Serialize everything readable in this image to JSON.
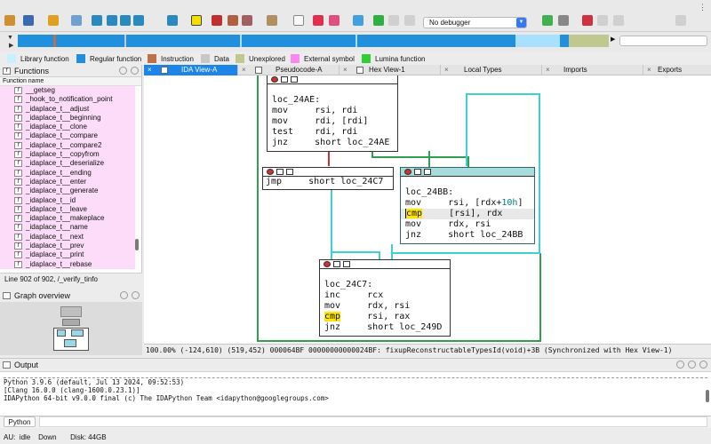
{
  "debugger": {
    "selected": "No debugger"
  },
  "legend": [
    {
      "label": "Library function",
      "color": "#c8f0ff"
    },
    {
      "label": "Regular function",
      "color": "#1f8fde"
    },
    {
      "label": "Instruction",
      "color": "#c07048"
    },
    {
      "label": "Data",
      "color": "#c8c8c8"
    },
    {
      "label": "Unexplored",
      "color": "#c0c890"
    },
    {
      "label": "External symbol",
      "color": "#ff86f0"
    },
    {
      "label": "Lumina function",
      "color": "#30d030"
    }
  ],
  "tabs": [
    {
      "label": "IDA View-A",
      "active": true
    },
    {
      "label": "Pseudocode-A"
    },
    {
      "label": "Hex View-1"
    },
    {
      "label": "Local Types"
    },
    {
      "label": "Imports"
    },
    {
      "label": "Exports"
    }
  ],
  "functions": {
    "title": "Functions",
    "column": "Function name",
    "items": [
      "__getseg",
      "_hook_to_notification_point",
      "_idaplace_t__adjust",
      "_idaplace_t__beginning",
      "_idaplace_t__clone",
      "_idaplace_t__compare",
      "_idaplace_t__compare2",
      "_idaplace_t__copyfrom",
      "_idaplace_t__deserialize",
      "_idaplace_t__ending",
      "_idaplace_t__enter",
      "_idaplace_t__generate",
      "_idaplace_t__id",
      "_idaplace_t__leave",
      "_idaplace_t__makeplace",
      "_idaplace_t__name",
      "_idaplace_t__next",
      "_idaplace_t__prev",
      "_idaplace_t__print",
      "_idaplace_t__rebase"
    ],
    "status": "Line 902 of 902, /_verify_tinfo"
  },
  "graph_overview": {
    "title": "Graph overview"
  },
  "nodes": {
    "n1": [
      "",
      "loc_24AE:",
      "mov     rsi, rdi",
      "mov     rdi, [rdi]",
      "test    rdi, rdi",
      "jnz     short loc_24AE"
    ],
    "n2": [
      "jmp     short loc_24C7"
    ],
    "n3_pre": [
      "",
      "loc_24BB:",
      "mov     rsi, [rdx+",
      "10h",
      "]"
    ],
    "n3": {
      "label": "loc_24BB:",
      "l1_pre": "mov     rsi, [rdx+",
      "l1_num": "10h",
      "l1_post": "]",
      "l2_op": "cmp",
      "l2_rest": "     [rsi], rdx",
      "l3": "mov     rdx, rsi",
      "l4": "jnz     short loc_24BB"
    },
    "n4": {
      "label": "loc_24C7:",
      "l1": "inc     rcx",
      "l2": "mov     rdx, rsi",
      "l3_op": "cmp",
      "l3_rest": "     rsi, rax",
      "l4": "jnz     short loc_249D"
    }
  },
  "ida_status": "100.00% (-124,610) (519,452) 000064BF 00000000000024BF: fixupReconstructableTypesId(void)+3B (Synchronized with Hex View-1)",
  "output": {
    "title": "Output",
    "lines": [
      "Python 3.9.6 (default, Jul 13 2024, 09:52:53)",
      "[Clang 16.0.0 (clang-1600.0.23.1)]",
      "IDAPython 64-bit v9.0.0 final (c) The IDAPython Team <idapython@googlegroups.com>"
    ],
    "cli_label": "Python"
  },
  "statusbar": {
    "au": "AU:",
    "state": "idle",
    "dir": "Down",
    "disk": "Disk: 44GB"
  }
}
